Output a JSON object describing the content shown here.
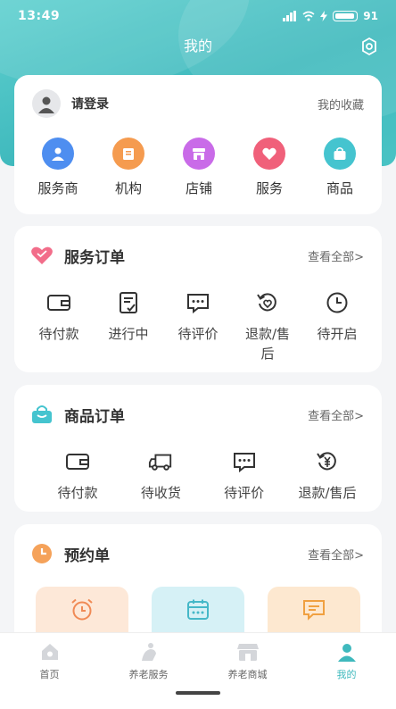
{
  "status_bar": {
    "time": "13:49",
    "battery": "91"
  },
  "header": {
    "title": "我的",
    "settings_icon": "settings-icon"
  },
  "profile": {
    "login_text": "请登录",
    "favorites_link": "我的收藏",
    "quick_links": [
      {
        "label": "服务商",
        "icon": "service-provider-icon",
        "color": "#4e8ef0"
      },
      {
        "label": "机构",
        "icon": "institution-icon",
        "color": "#f59b4f"
      },
      {
        "label": "店铺",
        "icon": "store-icon",
        "color": "#c96be8"
      },
      {
        "label": "服务",
        "icon": "service-icon",
        "color": "#f0607a"
      },
      {
        "label": "商品",
        "icon": "product-icon",
        "color": "#45c4cf"
      }
    ]
  },
  "service_orders": {
    "title": "服务订单",
    "view_all": "查看全部>",
    "items": [
      {
        "label": "待付款",
        "icon": "wallet-icon"
      },
      {
        "label": "进行中",
        "icon": "checklist-icon"
      },
      {
        "label": "待评价",
        "icon": "comment-icon"
      },
      {
        "label": "退款/售后",
        "icon": "refund-icon"
      },
      {
        "label": "待开启",
        "icon": "clock-icon"
      }
    ]
  },
  "goods_orders": {
    "title": "商品订单",
    "view_all": "查看全部>",
    "items": [
      {
        "label": "待付款",
        "icon": "wallet-icon"
      },
      {
        "label": "待收货",
        "icon": "truck-icon"
      },
      {
        "label": "待评价",
        "icon": "comment-icon"
      },
      {
        "label": "退款/售后",
        "icon": "yuan-refund-icon"
      }
    ]
  },
  "appointments": {
    "title": "预约单",
    "view_all": "查看全部>",
    "tiles": [
      {
        "icon": "alarm-clock-icon",
        "bg": "#fde8d8",
        "color": "#f08a55"
      },
      {
        "icon": "calendar-icon",
        "bg": "#d6f1f6",
        "color": "#45b8c8"
      },
      {
        "icon": "message-icon",
        "bg": "#fde8d0",
        "color": "#f0a040"
      }
    ]
  },
  "tabbar": {
    "tabs": [
      {
        "label": "首页",
        "icon": "home-icon",
        "active": false
      },
      {
        "label": "养老服务",
        "icon": "elderly-service-icon",
        "active": false
      },
      {
        "label": "养老商城",
        "icon": "mall-icon",
        "active": false
      },
      {
        "label": "我的",
        "icon": "profile-icon",
        "active": true
      }
    ]
  },
  "colors": {
    "brand": "#3fb9bd",
    "background": "#f4f5f7"
  }
}
